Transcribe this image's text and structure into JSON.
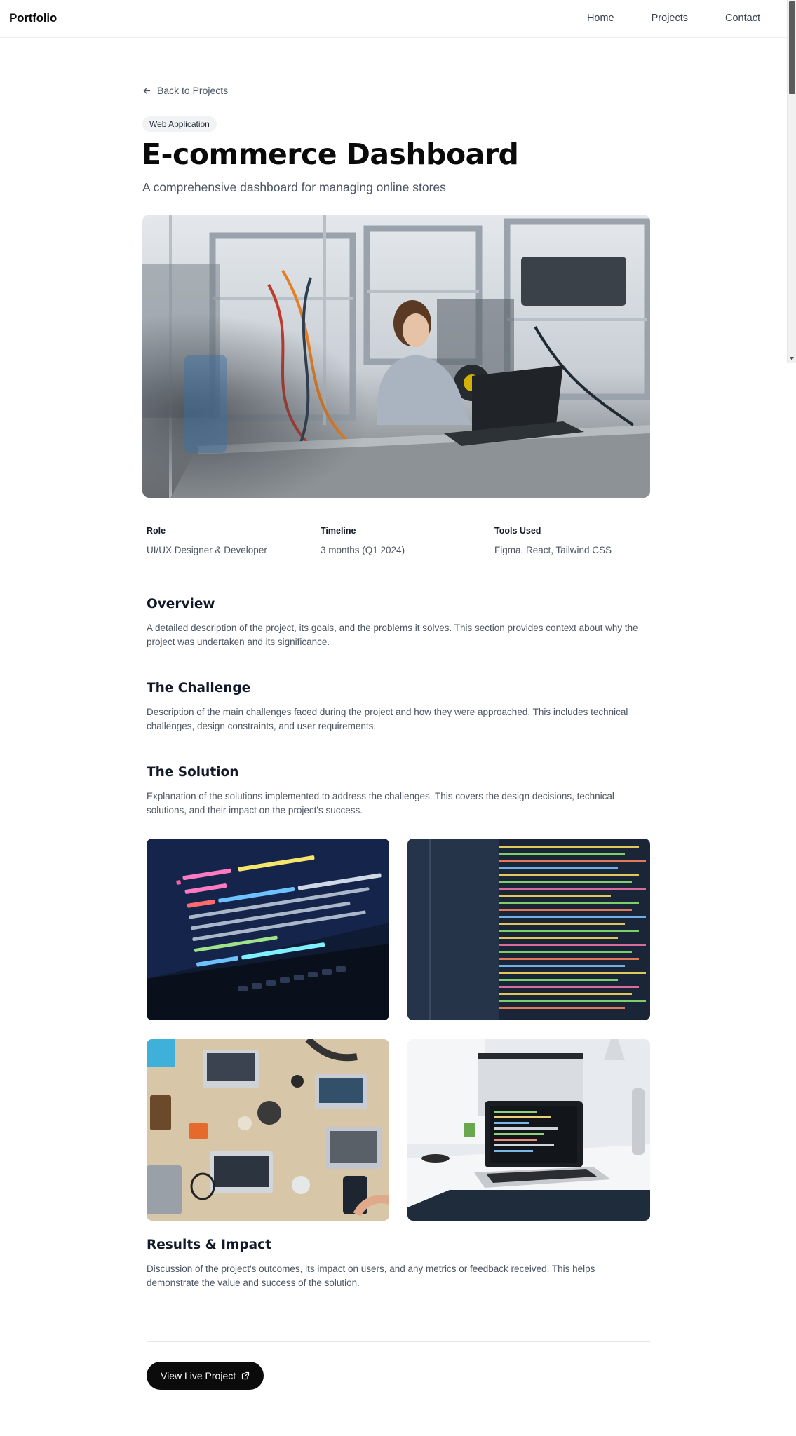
{
  "nav": {
    "brand": "Portfolio",
    "links": [
      "Home",
      "Projects",
      "Contact"
    ]
  },
  "back_link": "Back to Projects",
  "badge": "Web Application",
  "title": "E-commerce Dashboard",
  "subtitle": "A comprehensive dashboard for managing online stores",
  "meta": [
    {
      "label": "Role",
      "value": "UI/UX Designer & Developer"
    },
    {
      "label": "Timeline",
      "value": "3 months (Q1 2024)"
    },
    {
      "label": "Tools Used",
      "value": "Figma, React, Tailwind CSS"
    }
  ],
  "sections": {
    "overview": {
      "heading": "Overview",
      "body": "A detailed description of the project, its goals, and the problems it solves. This section provides context about why the project was undertaken and its significance."
    },
    "challenge": {
      "heading": "The Challenge",
      "body": "Description of the main challenges faced during the project and how they were approached. This includes technical challenges, design constraints, and user requirements."
    },
    "solution": {
      "heading": "The Solution",
      "body": "Explanation of the solutions implemented to address the challenges. This covers the design decisions, technical solutions, and their impact on the project's success."
    },
    "results": {
      "heading": "Results & Impact",
      "body": "Discussion of the project's outcomes, its impact on users, and any metrics or feedback received. This helps demonstrate the value and success of the solution."
    }
  },
  "cta": "View Live Project",
  "icons": {
    "back": "arrow-left-icon",
    "external": "external-link-icon"
  }
}
